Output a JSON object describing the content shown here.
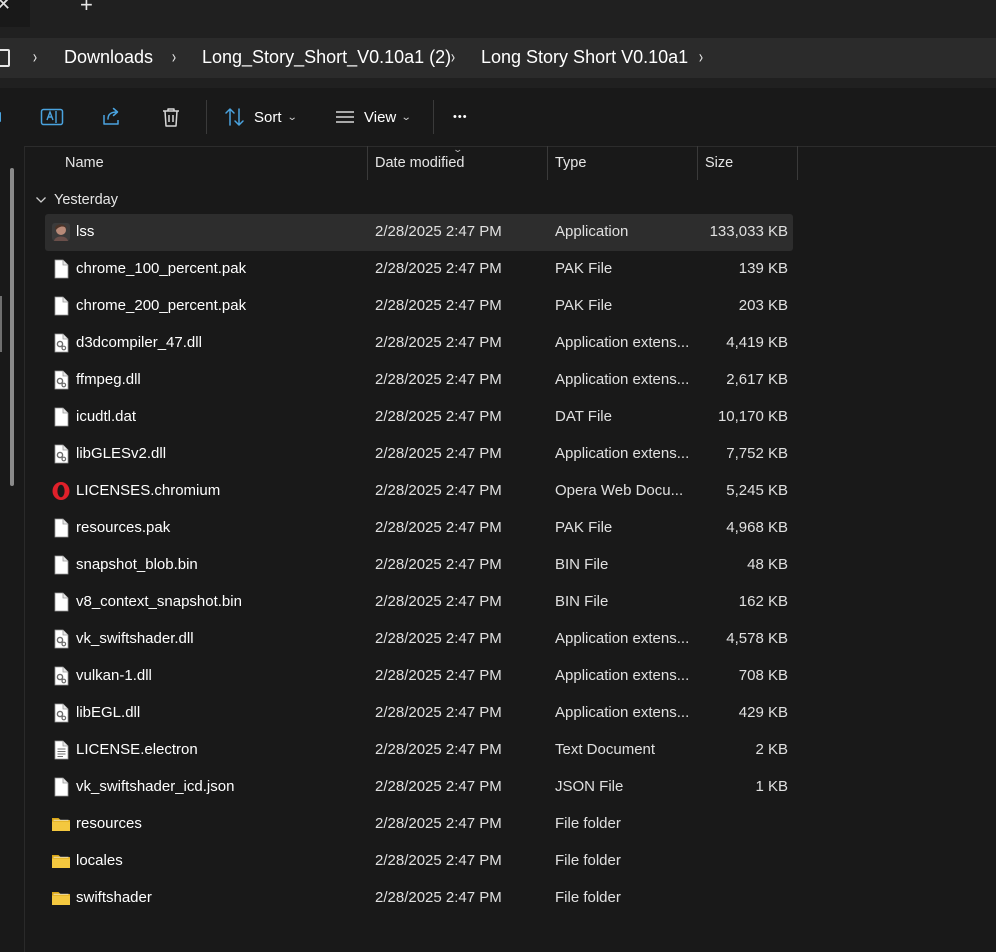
{
  "colors": {
    "window_bg": "#191919",
    "addressbar_bg": "#2b2b2b",
    "selected_row": "#2d2d2d",
    "folder_yellow": "#f1c232",
    "opera_red": "#e0202a"
  },
  "tabs": {
    "close_glyph": "✕",
    "new_tab_glyph": "+"
  },
  "breadcrumb": {
    "separator": "›",
    "items": [
      "Downloads",
      "Long_Story_Short_V0.10a1 (2)",
      "Long Story Short V0.10a1"
    ]
  },
  "toolbar": {
    "sort_label": "Sort",
    "view_label": "View",
    "more_glyph": "•••",
    "caret": "⌄"
  },
  "columns": {
    "name": "Name",
    "date": "Date modified",
    "type": "Type",
    "size": "Size",
    "sort_indicator": "⌄"
  },
  "group": {
    "label": "Yesterday"
  },
  "files": [
    {
      "name": "lss",
      "date": "2/28/2025 2:47 PM",
      "type": "Application",
      "size": "133,033 KB",
      "icon": "app-icon"
    },
    {
      "name": "chrome_100_percent.pak",
      "date": "2/28/2025 2:47 PM",
      "type": "PAK File",
      "size": "139 KB",
      "icon": "file-icon"
    },
    {
      "name": "chrome_200_percent.pak",
      "date": "2/28/2025 2:47 PM",
      "type": "PAK File",
      "size": "203 KB",
      "icon": "file-icon"
    },
    {
      "name": "d3dcompiler_47.dll",
      "date": "2/28/2025 2:47 PM",
      "type": "Application extens...",
      "size": "4,419 KB",
      "icon": "dll-icon"
    },
    {
      "name": "ffmpeg.dll",
      "date": "2/28/2025 2:47 PM",
      "type": "Application extens...",
      "size": "2,617 KB",
      "icon": "dll-icon"
    },
    {
      "name": "icudtl.dat",
      "date": "2/28/2025 2:47 PM",
      "type": "DAT File",
      "size": "10,170 KB",
      "icon": "file-icon"
    },
    {
      "name": "libGLESv2.dll",
      "date": "2/28/2025 2:47 PM",
      "type": "Application extens...",
      "size": "7,752 KB",
      "icon": "dll-icon"
    },
    {
      "name": "LICENSES.chromium",
      "date": "2/28/2025 2:47 PM",
      "type": "Opera Web Docu...",
      "size": "5,245 KB",
      "icon": "opera-icon"
    },
    {
      "name": "resources.pak",
      "date": "2/28/2025 2:47 PM",
      "type": "PAK File",
      "size": "4,968 KB",
      "icon": "file-icon"
    },
    {
      "name": "snapshot_blob.bin",
      "date": "2/28/2025 2:47 PM",
      "type": "BIN File",
      "size": "48 KB",
      "icon": "file-icon"
    },
    {
      "name": "v8_context_snapshot.bin",
      "date": "2/28/2025 2:47 PM",
      "type": "BIN File",
      "size": "162 KB",
      "icon": "file-icon"
    },
    {
      "name": "vk_swiftshader.dll",
      "date": "2/28/2025 2:47 PM",
      "type": "Application extens...",
      "size": "4,578 KB",
      "icon": "dll-icon"
    },
    {
      "name": "vulkan-1.dll",
      "date": "2/28/2025 2:47 PM",
      "type": "Application extens...",
      "size": "708 KB",
      "icon": "dll-icon"
    },
    {
      "name": "libEGL.dll",
      "date": "2/28/2025 2:47 PM",
      "type": "Application extens...",
      "size": "429 KB",
      "icon": "dll-icon"
    },
    {
      "name": "LICENSE.electron",
      "date": "2/28/2025 2:47 PM",
      "type": "Text Document",
      "size": "2 KB",
      "icon": "text-file-icon"
    },
    {
      "name": "vk_swiftshader_icd.json",
      "date": "2/28/2025 2:47 PM",
      "type": "JSON File",
      "size": "1 KB",
      "icon": "file-icon"
    },
    {
      "name": "resources",
      "date": "2/28/2025 2:47 PM",
      "type": "File folder",
      "size": "",
      "icon": "folder-icon"
    },
    {
      "name": "locales",
      "date": "2/28/2025 2:47 PM",
      "type": "File folder",
      "size": "",
      "icon": "folder-icon"
    },
    {
      "name": "swiftshader",
      "date": "2/28/2025 2:47 PM",
      "type": "File folder",
      "size": "",
      "icon": "folder-icon"
    }
  ]
}
